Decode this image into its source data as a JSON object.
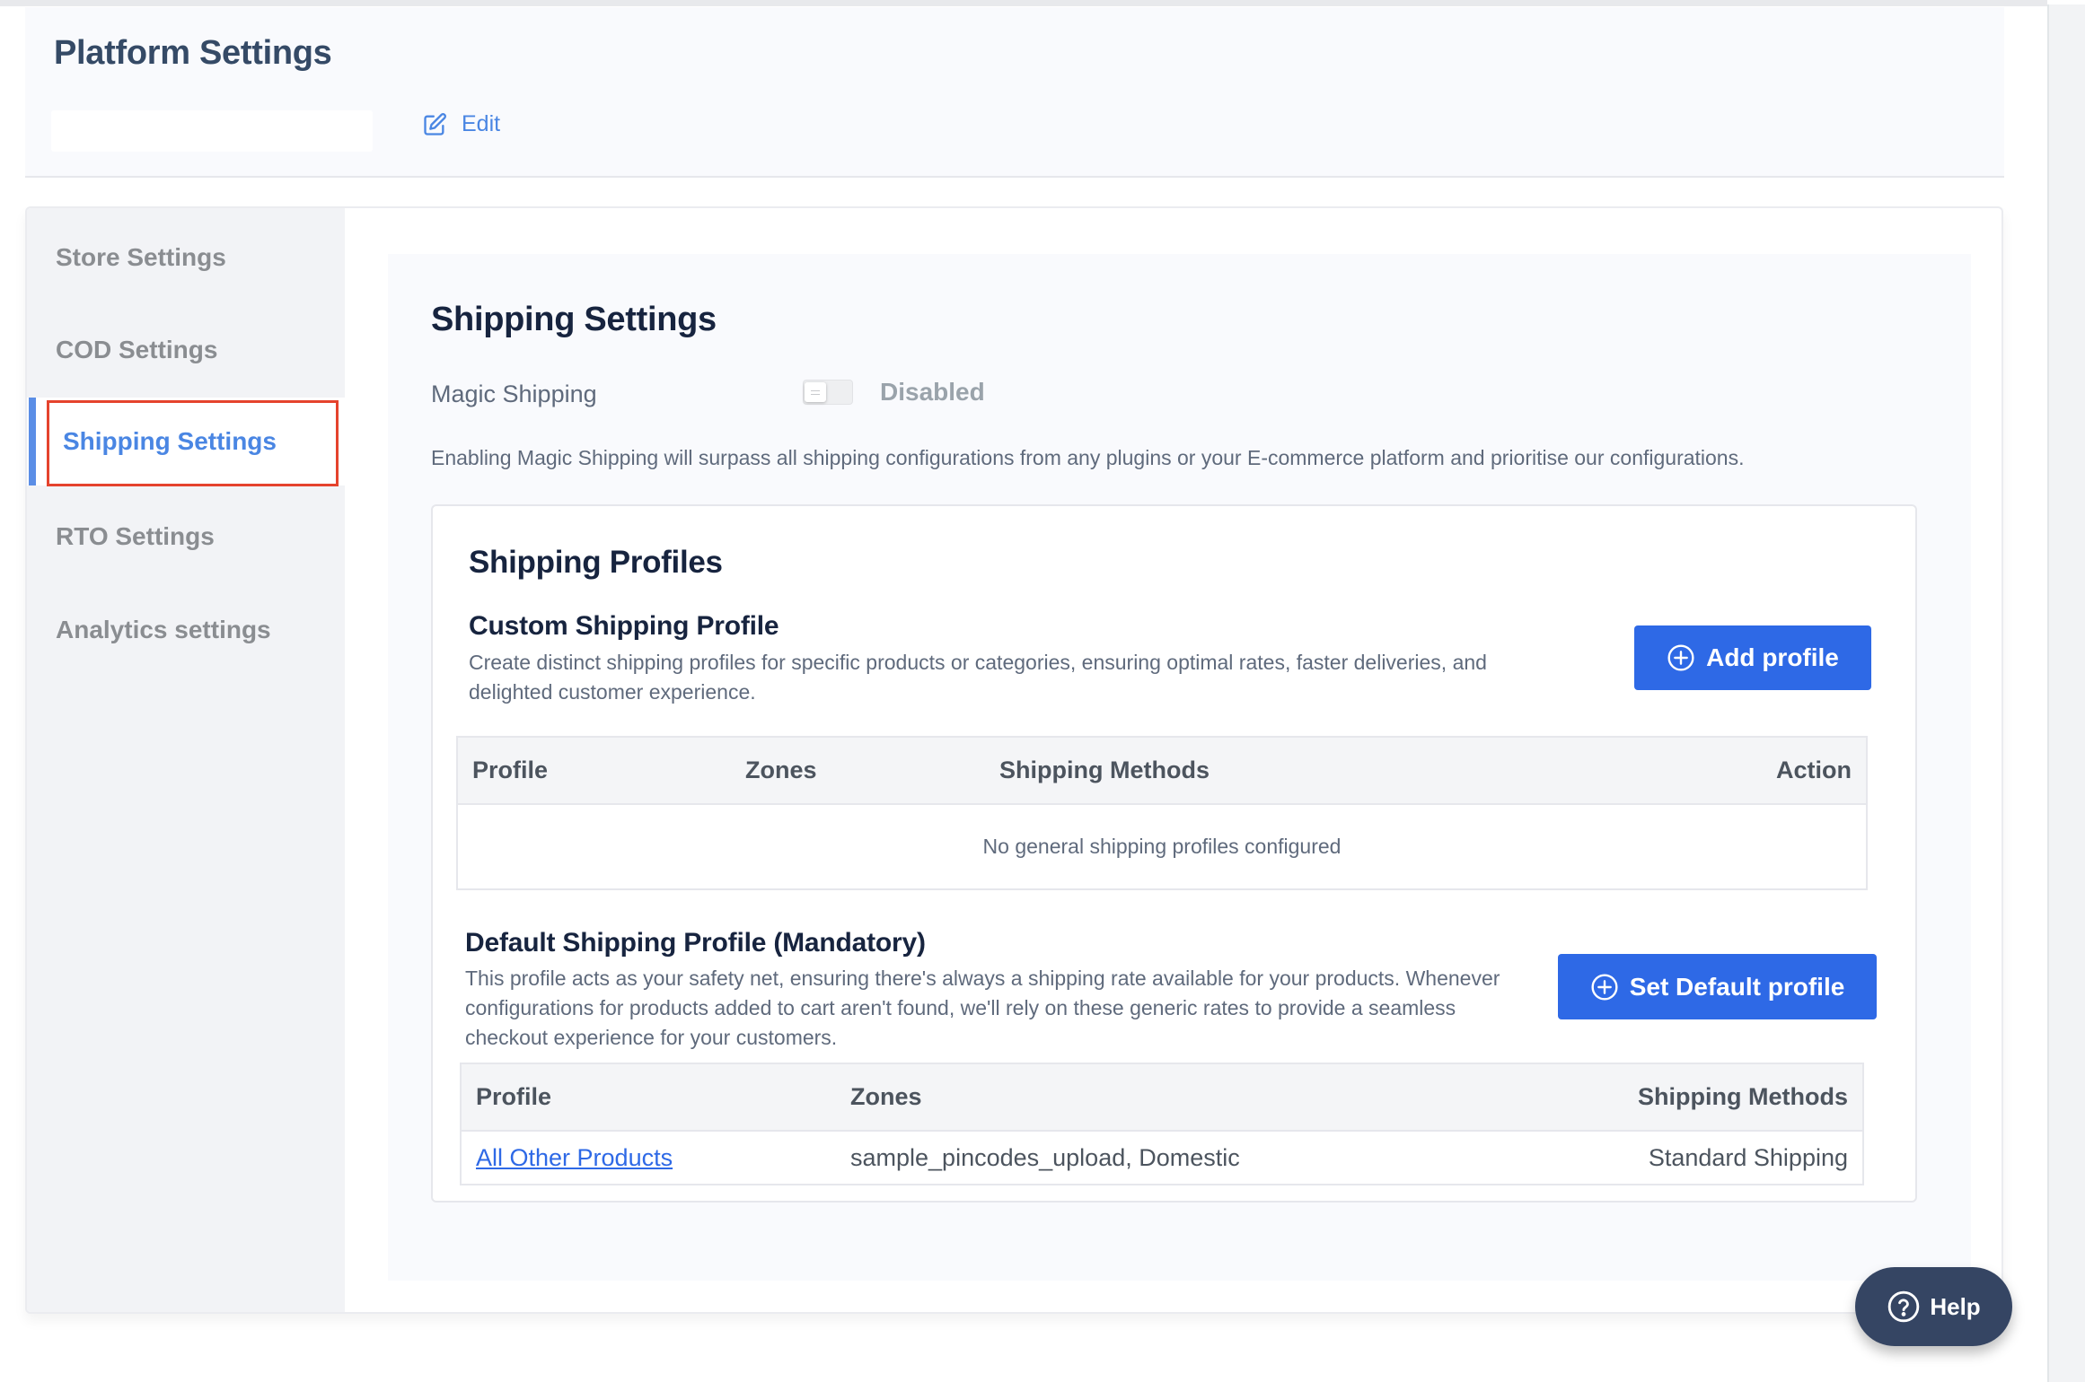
{
  "header": {
    "title": "Platform Settings",
    "store_name_value": "",
    "edit_label": "Edit"
  },
  "sidebar": {
    "items": [
      {
        "label": "Store Settings",
        "active": false
      },
      {
        "label": "COD Settings",
        "active": false
      },
      {
        "label": "Shipping Settings",
        "active": true
      },
      {
        "label": "RTO Settings",
        "active": false
      },
      {
        "label": "Analytics settings",
        "active": false
      }
    ]
  },
  "shipping": {
    "title": "Shipping Settings",
    "magic_shipping": {
      "label": "Magic Shipping",
      "enabled": false,
      "status": "Disabled",
      "description": "Enabling Magic Shipping will surpass all shipping configurations from any plugins or your E-commerce platform and prioritise our configurations."
    },
    "profiles": {
      "title": "Shipping Profiles",
      "custom": {
        "title": "Custom Shipping Profile",
        "description": "Create distinct shipping profiles for specific products or categories, ensuring optimal rates, faster deliveries, and delighted customer experience.",
        "button_label": "Add profile",
        "columns": [
          "Profile",
          "Zones",
          "Shipping Methods",
          "Action"
        ],
        "empty_text": "No general shipping profiles configured",
        "rows": []
      },
      "default": {
        "title": "Default Shipping Profile (Mandatory)",
        "description": "This profile acts as your safety net, ensuring there's always a shipping rate available for your products. Whenever configurations for products added to cart aren't found, we'll rely on these generic rates to provide a seamless checkout experience for your customers.",
        "button_label": "Set Default profile",
        "columns": [
          "Profile",
          "Zones",
          "Shipping Methods"
        ],
        "rows": [
          {
            "profile": "All Other Products",
            "zones": "sample_pincodes_upload, Domestic",
            "methods": "Standard Shipping"
          }
        ]
      }
    }
  },
  "help": {
    "label": "Help"
  },
  "colors": {
    "primary": "#2e69e6",
    "link": "#4a86e3",
    "highlight_box": "#e5432d",
    "help_bg": "#354563"
  }
}
